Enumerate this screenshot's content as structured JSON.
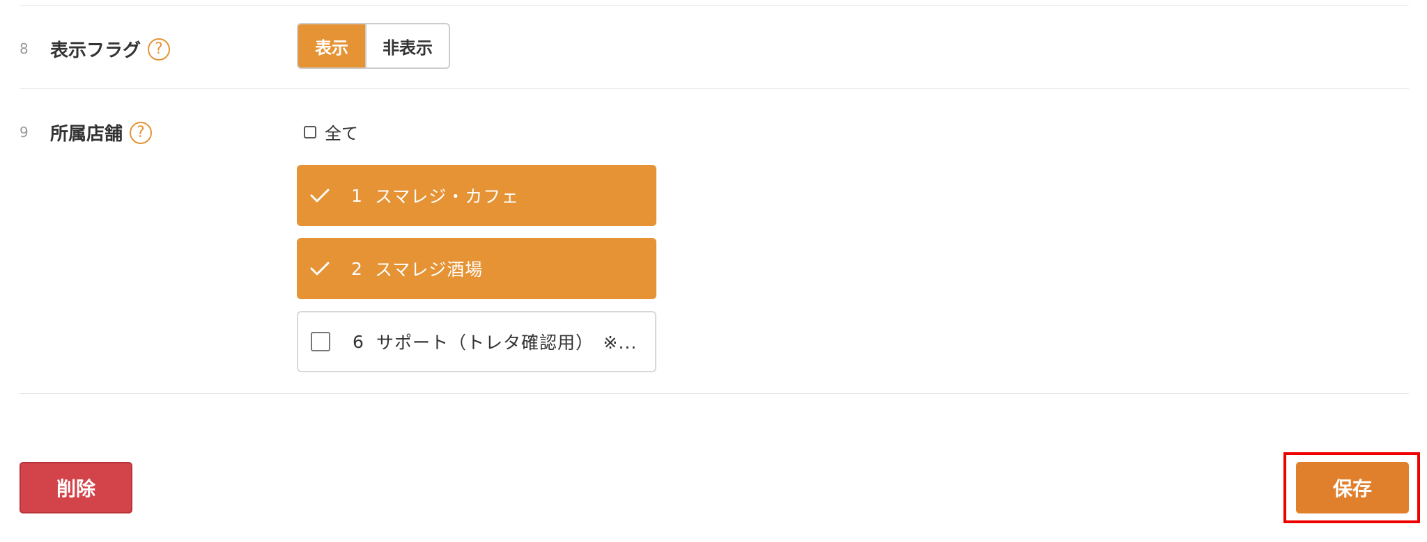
{
  "form": {
    "rows": [
      {
        "number": "8",
        "label": "表示フラグ",
        "help": "?",
        "options": [
          "表示",
          "非表示"
        ],
        "selected": "表示"
      },
      {
        "number": "9",
        "label": "所属店舗",
        "help": "?",
        "select_all_label": "全て",
        "stores": [
          {
            "id": "1",
            "name": "スマレジ・カフェ",
            "checked": true
          },
          {
            "id": "2",
            "name": "スマレジ酒場",
            "checked": true
          },
          {
            "id": "6",
            "name": "サポート（トレタ確認用）　※...",
            "checked": false
          }
        ]
      }
    ]
  },
  "actions": {
    "delete_label": "削除",
    "save_label": "保存"
  },
  "colors": {
    "accent": "#e59334",
    "danger": "#d2434a",
    "save": "#e0802d",
    "highlight": "#ee0000"
  }
}
